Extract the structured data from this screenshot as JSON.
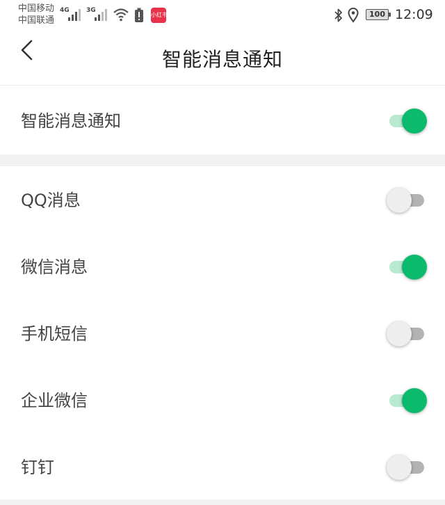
{
  "status_bar": {
    "carrier_1": "中国移动",
    "carrier_2": "中国联通",
    "network_1": "4G",
    "network_2": "3G",
    "app_badge": "小红书",
    "battery": "100",
    "time": "12:09"
  },
  "header": {
    "title": "智能消息通知",
    "back_icon": "chevron-left-icon"
  },
  "master_toggle": {
    "label": "智能消息通知",
    "enabled": true
  },
  "apps": [
    {
      "label": "QQ消息",
      "enabled": false
    },
    {
      "label": "微信消息",
      "enabled": true
    },
    {
      "label": "手机短信",
      "enabled": false
    },
    {
      "label": "企业微信",
      "enabled": true
    },
    {
      "label": "钉钉",
      "enabled": false
    }
  ],
  "colors": {
    "accent": "#0cba6e",
    "accent_track": "#b9ead1",
    "off_track": "#b3b3b3",
    "off_knob": "#eeeeee",
    "divider": "#f1f1f1"
  }
}
